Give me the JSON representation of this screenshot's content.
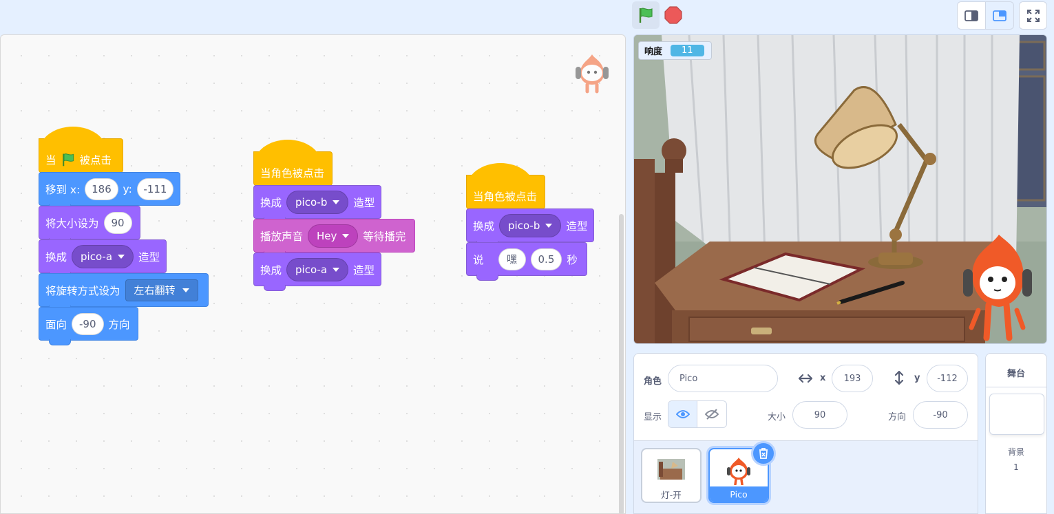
{
  "code": {
    "script1": {
      "hat_prefix": "当",
      "hat_suffix": "被点击",
      "goto_label": "移到 x:",
      "goto_x": "186",
      "goto_y_label": "y:",
      "goto_y": "-111",
      "size_label": "将大小设为",
      "size_value": "90",
      "costume_label": "换成",
      "costume_value": "pico-a",
      "costume_suffix": "造型",
      "rotation_label": "将旋转方式设为",
      "rotation_value": "左右翻转",
      "point_label": "面向",
      "point_value": "-90",
      "point_suffix": "方向"
    },
    "script2": {
      "hat_label": "当角色被点击",
      "costume1_label": "换成",
      "costume1_value": "pico-b",
      "costume1_suffix": "造型",
      "sound_label": "播放声音",
      "sound_value": "Hey",
      "sound_suffix": "等待播完",
      "costume2_label": "换成",
      "costume2_value": "pico-a",
      "costume2_suffix": "造型"
    },
    "script3": {
      "hat_label": "当角色被点击",
      "costume_label": "换成",
      "costume_value": "pico-b",
      "costume_suffix": "造型",
      "say_label": "说",
      "say_text": "嘿",
      "say_secs": "0.5",
      "say_suffix": "秒"
    }
  },
  "stage": {
    "variable_name": "响度",
    "variable_value": "11"
  },
  "sprite_info": {
    "sprite_label": "角色",
    "sprite_name": "Pico",
    "x_label": "x",
    "x_value": "193",
    "y_label": "y",
    "y_value": "-112",
    "show_label": "显示",
    "size_label": "大小",
    "size_value": "90",
    "direction_label": "方向",
    "direction_value": "-90"
  },
  "sprites": [
    {
      "name": "灯-开",
      "selected": false
    },
    {
      "name": "Pico",
      "selected": true
    }
  ],
  "stage_selector": {
    "title": "舞台",
    "backdrops_label": "背景",
    "backdrops_count": "1"
  },
  "colors": {
    "events": "#ffbf00",
    "motion": "#4c97ff",
    "looks": "#9966ff",
    "sound": "#cf63cf",
    "accent": "#4c97ff"
  },
  "icons": [
    "green-flag-icon",
    "stop-icon",
    "small-stage-icon",
    "large-stage-icon",
    "fullscreen-icon",
    "eye-icon",
    "eye-slash-icon",
    "trash-icon",
    "horizontal-arrows-icon",
    "vertical-arrows-icon"
  ]
}
